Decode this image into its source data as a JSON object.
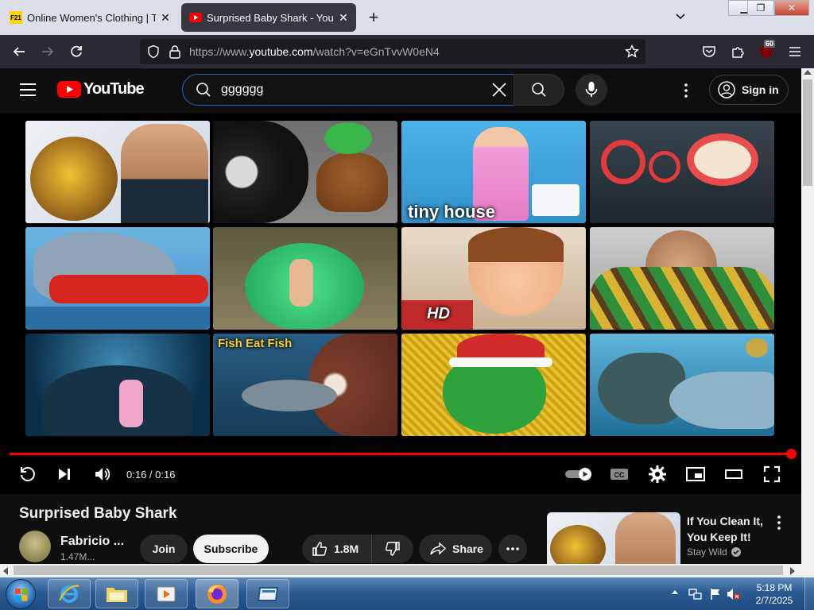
{
  "browser": {
    "tabs": [
      {
        "label": "Online Women's Clothing | Tren",
        "favicon": "F21",
        "active": false
      },
      {
        "label": "Surprised Baby Shark - YouTube",
        "active": true
      }
    ],
    "url_prefix": "https://www.",
    "url_host": "youtube.com",
    "url_rest": "/watch?v=eGnTvvW0eN4",
    "extension_badge": "60"
  },
  "youtube": {
    "logo_text": "YouTube",
    "search_value": "gggggg",
    "sign_in": "Sign in"
  },
  "thumbnails": [
    {
      "label": ""
    },
    {
      "label": ""
    },
    {
      "label": "tiny house"
    },
    {
      "label": ""
    },
    {
      "label": ""
    },
    {
      "label": ""
    },
    {
      "label": "HD"
    },
    {
      "label": ""
    },
    {
      "label": ""
    },
    {
      "label": "Fish Eat Fish"
    },
    {
      "label": ""
    },
    {
      "label": ""
    }
  ],
  "player": {
    "time": "0:16 / 0:16",
    "progress_fraction": 1.0
  },
  "video": {
    "title": "Surprised Baby Shark",
    "channel": "Fabricio ...",
    "subscribers": "1.47M...",
    "join": "Join",
    "subscribe": "Subscribe",
    "likes": "1.8M",
    "share": "Share"
  },
  "recommendation": {
    "title_line1": "If You Clean It,",
    "title_line2": "You Keep It!",
    "channel": "Stay Wild"
  },
  "taskbar": {
    "time": "5:18 PM",
    "date": "2/7/2025"
  },
  "colors": {
    "accent_red": "#ff0000",
    "search_border": "#1c62b9",
    "firefox_toolbar": "#2b2a33"
  }
}
